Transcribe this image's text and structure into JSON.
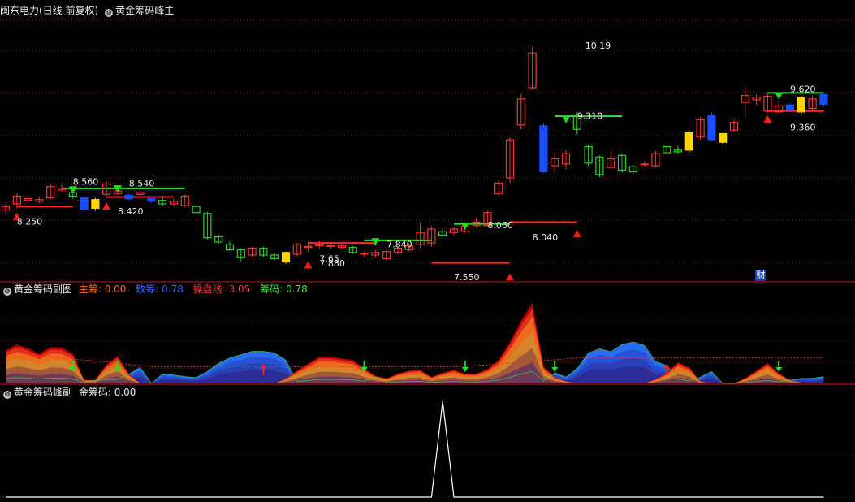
{
  "panel1": {
    "stock": "闽东电力(日线 前复权)",
    "indicator": "黄金筹码峰主"
  },
  "panel2": {
    "indicator": "黄金筹码副图",
    "items": [
      {
        "label": "主筹:",
        "value": "0.00",
        "color": "#ff6a00"
      },
      {
        "label": "散筹:",
        "value": "0.78",
        "color": "#2f63ff"
      },
      {
        "label": "操盘线:",
        "value": "3.05",
        "color": "#ff2a2a"
      },
      {
        "label": "筹码:",
        "value": "0.78",
        "color": "#39e639"
      }
    ]
  },
  "panel3": {
    "indicator": "黄金筹码峰副",
    "items": [
      {
        "label": "金筹码:",
        "value": "0.00",
        "color": "#e8e8e8"
      }
    ]
  },
  "badge": "财",
  "colors": {
    "up": "#ff3030",
    "down": "#28d428",
    "hline_red": "#ff2a2a",
    "hline_green": "#2ee82e",
    "blue_bar": "#1a4dff",
    "yellow_bar": "#ffd400"
  },
  "chart_data": {
    "type": "candlestick",
    "ylim": [
      7.5,
      10.45
    ],
    "price_labels": [
      "8.250",
      "8.560",
      "8.420",
      "8.540",
      "7.880",
      "7.65",
      "7.840",
      "7.550",
      "8.060",
      "8.040",
      "10.19",
      "9.310",
      "9.620",
      "9.360"
    ],
    "candles": [
      {
        "o": 8.31,
        "c": 8.35,
        "h": 8.38,
        "l": 8.27
      },
      {
        "o": 8.38,
        "c": 8.47,
        "h": 8.5,
        "l": 8.33
      },
      {
        "o": 8.42,
        "c": 8.44,
        "h": 8.48,
        "l": 8.4
      },
      {
        "o": 8.41,
        "c": 8.43,
        "h": 8.46,
        "l": 8.39
      },
      {
        "o": 8.45,
        "c": 8.58,
        "h": 8.61,
        "l": 8.43
      },
      {
        "o": 8.54,
        "c": 8.56,
        "h": 8.6,
        "l": 8.52
      },
      {
        "o": 8.51,
        "c": 8.47,
        "h": 8.55,
        "l": 8.44
      },
      {
        "o": 8.45,
        "c": 8.32,
        "h": 8.48,
        "l": 8.29,
        "fill": "blue"
      },
      {
        "o": 8.33,
        "c": 8.43,
        "h": 8.45,
        "l": 8.3,
        "fill": "yellow"
      },
      {
        "o": 8.49,
        "c": 8.61,
        "h": 8.64,
        "l": 8.47
      },
      {
        "o": 8.5,
        "c": 8.53,
        "h": 8.56,
        "l": 8.48
      },
      {
        "o": 8.48,
        "c": 8.44,
        "h": 8.51,
        "l": 8.42,
        "fill": "blue"
      },
      {
        "o": 8.49,
        "c": 8.51,
        "h": 8.54,
        "l": 8.46
      },
      {
        "o": 8.44,
        "c": 8.41,
        "h": 8.47,
        "l": 8.39,
        "fill": "blue"
      },
      {
        "o": 8.42,
        "c": 8.38,
        "h": 8.45,
        "l": 8.36
      },
      {
        "o": 8.38,
        "c": 8.41,
        "h": 8.44,
        "l": 8.35
      },
      {
        "o": 8.36,
        "c": 8.47,
        "h": 8.49,
        "l": 8.34
      },
      {
        "o": 8.35,
        "c": 8.28,
        "h": 8.37,
        "l": 8.26
      },
      {
        "o": 8.27,
        "c": 7.99,
        "h": 8.29,
        "l": 7.97
      },
      {
        "o": 8.0,
        "c": 7.94,
        "h": 8.02,
        "l": 7.92
      },
      {
        "o": 7.91,
        "c": 7.85,
        "h": 7.95,
        "l": 7.84
      },
      {
        "o": 7.85,
        "c": 7.76,
        "h": 7.87,
        "l": 7.72
      },
      {
        "o": 7.79,
        "c": 7.87,
        "h": 7.89,
        "l": 7.77
      },
      {
        "o": 7.87,
        "c": 7.79,
        "h": 7.89,
        "l": 7.77
      },
      {
        "o": 7.79,
        "c": 7.75,
        "h": 7.81,
        "l": 7.73
      },
      {
        "o": 7.71,
        "c": 7.82,
        "h": 7.83,
        "l": 7.69,
        "fill": "yellow"
      },
      {
        "o": 7.8,
        "c": 7.91,
        "h": 7.93,
        "l": 7.78
      },
      {
        "o": 7.88,
        "c": 7.89,
        "h": 7.95,
        "l": 7.83
      },
      {
        "o": 7.9,
        "c": 7.92,
        "h": 7.95,
        "l": 7.87
      },
      {
        "o": 7.9,
        "c": 7.9,
        "h": 7.94,
        "l": 7.86
      },
      {
        "o": 7.88,
        "c": 7.9,
        "h": 7.92,
        "l": 7.85
      },
      {
        "o": 7.88,
        "c": 7.82,
        "h": 7.9,
        "l": 7.8
      },
      {
        "o": 7.8,
        "c": 7.81,
        "h": 7.83,
        "l": 7.77
      },
      {
        "o": 7.79,
        "c": 7.82,
        "h": 7.85,
        "l": 7.76
      },
      {
        "o": 7.75,
        "c": 7.83,
        "h": 7.85,
        "l": 7.73
      },
      {
        "o": 7.82,
        "c": 7.87,
        "h": 7.9,
        "l": 7.8
      },
      {
        "o": 7.85,
        "c": 7.9,
        "h": 7.93,
        "l": 7.83
      },
      {
        "o": 7.91,
        "c": 8.05,
        "h": 8.17,
        "l": 7.87
      },
      {
        "o": 7.93,
        "c": 8.09,
        "h": 8.12,
        "l": 7.89
      },
      {
        "o": 8.06,
        "c": 8.02,
        "h": 8.1,
        "l": 8.0
      },
      {
        "o": 8.05,
        "c": 8.09,
        "h": 8.11,
        "l": 8.02
      },
      {
        "o": 8.06,
        "c": 8.12,
        "h": 8.17,
        "l": 8.04
      },
      {
        "o": 8.13,
        "c": 8.17,
        "h": 8.22,
        "l": 8.1
      },
      {
        "o": 8.13,
        "c": 8.28,
        "h": 8.3,
        "l": 8.11
      },
      {
        "o": 8.5,
        "c": 8.62,
        "h": 8.66,
        "l": 8.47
      },
      {
        "o": 8.68,
        "c": 9.12,
        "h": 9.15,
        "l": 8.62
      },
      {
        "o": 9.29,
        "c": 9.59,
        "h": 9.65,
        "l": 9.24
      },
      {
        "o": 9.72,
        "c": 10.12,
        "h": 10.19,
        "l": 9.7
      },
      {
        "o": 9.28,
        "c": 8.75,
        "h": 9.31,
        "l": 8.73,
        "fill": "blue"
      },
      {
        "o": 8.82,
        "c": 8.9,
        "h": 8.98,
        "l": 8.73
      },
      {
        "o": 8.84,
        "c": 8.96,
        "h": 9.0,
        "l": 8.78
      },
      {
        "o": 9.4,
        "c": 9.24,
        "h": 9.44,
        "l": 9.18
      },
      {
        "o": 9.04,
        "c": 8.85,
        "h": 9.06,
        "l": 8.82
      },
      {
        "o": 8.92,
        "c": 8.72,
        "h": 8.94,
        "l": 8.69
      },
      {
        "o": 8.8,
        "c": 8.9,
        "h": 8.99,
        "l": 8.78
      },
      {
        "o": 8.94,
        "c": 8.77,
        "h": 8.96,
        "l": 8.74
      },
      {
        "o": 8.81,
        "c": 8.75,
        "h": 8.83,
        "l": 8.72
      },
      {
        "o": 8.84,
        "c": 8.84,
        "h": 8.87,
        "l": 8.81
      },
      {
        "o": 8.82,
        "c": 8.96,
        "h": 8.99,
        "l": 8.8
      },
      {
        "o": 9.04,
        "c": 8.97,
        "h": 9.06,
        "l": 8.95
      },
      {
        "o": 9.0,
        "c": 8.98,
        "h": 9.05,
        "l": 8.96
      },
      {
        "o": 9.0,
        "c": 9.2,
        "h": 9.23,
        "l": 8.97,
        "fill": "yellow"
      },
      {
        "o": 9.15,
        "c": 9.35,
        "h": 9.38,
        "l": 9.12
      },
      {
        "o": 9.4,
        "c": 9.12,
        "h": 9.43,
        "l": 9.1,
        "fill": "blue"
      },
      {
        "o": 9.19,
        "c": 9.09,
        "h": 9.21,
        "l": 9.07,
        "fill": "yellow"
      },
      {
        "o": 9.23,
        "c": 9.32,
        "h": 9.35,
        "l": 9.21
      },
      {
        "o": 9.55,
        "c": 9.63,
        "h": 9.73,
        "l": 9.38
      },
      {
        "o": 9.58,
        "c": 9.61,
        "h": 9.64,
        "l": 9.52
      },
      {
        "o": 9.45,
        "c": 9.62,
        "h": 9.65,
        "l": 9.43
      },
      {
        "o": 9.44,
        "c": 9.51,
        "h": 9.57,
        "l": 9.41
      },
      {
        "o": 9.52,
        "c": 9.46,
        "h": 9.54,
        "l": 9.44,
        "fill": "blue"
      },
      {
        "o": 9.44,
        "c": 9.61,
        "h": 9.63,
        "l": 9.4,
        "fill": "yellow"
      },
      {
        "o": 9.48,
        "c": 9.59,
        "h": 9.63,
        "l": 9.46
      },
      {
        "o": 9.53,
        "c": 9.64,
        "h": 9.66,
        "l": 9.5,
        "fill": "blue"
      }
    ],
    "sub_series": [
      {
        "name": "主筹",
        "values": [
          0.78,
          0.92,
          0.83,
          0.7,
          0.86,
          0.85,
          0.7,
          0.08,
          0.08,
          0.45,
          0.65,
          0.22,
          0.0,
          0.0,
          0.0,
          0.0,
          0.0,
          0.0,
          0.0,
          0.0,
          0.0,
          0.0,
          0.0,
          0.0,
          0.0,
          0.12,
          0.3,
          0.47,
          0.63,
          0.63,
          0.59,
          0.55,
          0.35,
          0.18,
          0.12,
          0.23,
          0.3,
          0.32,
          0.15,
          0.25,
          0.32,
          0.23,
          0.23,
          0.34,
          0.55,
          0.98,
          1.48,
          1.9,
          0.4,
          0.15,
          0.05,
          0.0,
          0.0,
          0.0,
          0.0,
          0.0,
          0.0,
          0.0,
          0.1,
          0.25,
          0.5,
          0.38,
          0.05,
          0.0,
          0.0,
          0.0,
          0.12,
          0.3,
          0.48,
          0.24,
          0.08,
          0.02,
          0.0,
          0.0
        ]
      },
      {
        "name": "散筹",
        "values": [
          0.0,
          0.0,
          0.0,
          0.0,
          0.0,
          0.0,
          0.0,
          0.0,
          0.08,
          0.08,
          0.0,
          0.22,
          0.38,
          0.0,
          0.22,
          0.2,
          0.16,
          0.14,
          0.28,
          0.48,
          0.6,
          0.68,
          0.76,
          0.76,
          0.72,
          0.55,
          0.0,
          0.0,
          0.0,
          0.0,
          0.0,
          0.0,
          0.05,
          0.15,
          0.0,
          0.0,
          0.0,
          0.0,
          0.0,
          0.0,
          0.0,
          0.0,
          0.0,
          0.0,
          0.0,
          0.0,
          0.0,
          0.0,
          0.0,
          0.25,
          0.15,
          0.35,
          0.72,
          0.82,
          0.75,
          0.92,
          0.98,
          0.9,
          0.52,
          0.42,
          0.1,
          0.0,
          0.15,
          0.28,
          0.0,
          0.0,
          0.0,
          0.0,
          0.0,
          0.0,
          0.08,
          0.12,
          0.12,
          0.16
        ]
      },
      {
        "name": "操盘线",
        "values": [
          0.75,
          0.72,
          0.69,
          0.66,
          0.63,
          0.6,
          0.58,
          0.55,
          0.53,
          0.51,
          0.48,
          0.45,
          0.42,
          0.4,
          0.4,
          0.4,
          0.4,
          0.4,
          0.4,
          0.4,
          0.4,
          0.4,
          0.4,
          0.4,
          0.4,
          0.4,
          0.4,
          0.4,
          0.4,
          0.4,
          0.4,
          0.4,
          0.4,
          0.4,
          0.4,
          0.4,
          0.4,
          0.4,
          0.4,
          0.4,
          0.4,
          0.4,
          0.42,
          0.44,
          0.46,
          0.48,
          0.5,
          0.52,
          0.54,
          0.56,
          0.58,
          0.6,
          0.6,
          0.6,
          0.6,
          0.6,
          0.6,
          0.6,
          0.6,
          0.6,
          0.6,
          0.6,
          0.6,
          0.6,
          0.6,
          0.6,
          0.6,
          0.6,
          0.6,
          0.6,
          0.6,
          0.6,
          0.6,
          0.6
        ]
      },
      {
        "name": "金筹码",
        "values": [
          0,
          0,
          0,
          0,
          0,
          0,
          0,
          0,
          0,
          0,
          0,
          0,
          0,
          0,
          0,
          0,
          0,
          0,
          0,
          0,
          0,
          0,
          0,
          0,
          0,
          0,
          0,
          0,
          0,
          0,
          0,
          0,
          0,
          0,
          0,
          0,
          0,
          0,
          0,
          1,
          0,
          0,
          0,
          0,
          0,
          0,
          0,
          0,
          0,
          0,
          0,
          0,
          0,
          0,
          0,
          0,
          0,
          0,
          0,
          0,
          0,
          0,
          0,
          0,
          0,
          0,
          0,
          0,
          0,
          0,
          0,
          0,
          0,
          0
        ]
      }
    ]
  }
}
